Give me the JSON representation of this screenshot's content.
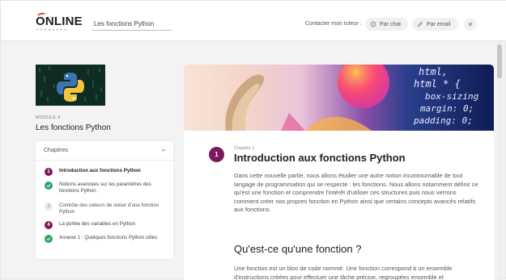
{
  "header": {
    "logo_text": "ONLINE",
    "logo_subtext": "FORMAPRO",
    "course_search_value": "Les fonctions Python",
    "tutor_label": "Contacter mon tuteur :",
    "chat_label": "Par chat",
    "email_label": "Par email",
    "close_label": "×"
  },
  "sidebar": {
    "module_label": "MODULE 4",
    "module_title": "Les fonctions Python",
    "chapters_label": "Chapitres",
    "chapters": [
      {
        "number": "1",
        "label": "Introduction aux fonctions Python",
        "state": "current"
      },
      {
        "number": "",
        "label": "Notions avancées sur les paramètres des fonctions Python",
        "state": "done"
      },
      {
        "number": "3",
        "label": "Contrôle des valeurs de retour d'une fonction Python",
        "state": "todo"
      },
      {
        "number": "4",
        "label": "La portée des variables en Python",
        "state": "current"
      },
      {
        "number": "",
        "label": "Annexe 1 : Quelques fonctions Python utiles",
        "state": "done"
      }
    ]
  },
  "main": {
    "hero_code": [
      "html,",
      "html * {",
      "box-sizing",
      "margin: 0;",
      "padding: 0;"
    ],
    "chapter_number": "1",
    "chapter_kicker": "Chapitre 1",
    "chapter_title": "Introduction aux fonctions Python",
    "intro_paragraph": "Dans cette nouvelle partie, nous allons étudier une autre notion incontournable de tout langage de programmation qui se respecte : les fonctions. Nous allons notamment définir ce qu'est une fonction et comprendre l'intérêt d'utiliser ces structures puis nous verrons comment créer nos propres fonction en Python ainsi que certains concepts avancés relatifs aux fonctions.",
    "section_title": "Qu'est-ce qu'une fonction ?",
    "section_paragraph": "Une fonction est un bloc de code nommé. Une fonction correspond à un ensemble d'instructions créées pour effectuer une tâche précise, regroupées ensemble et"
  },
  "colors": {
    "accent": "#7a1a5a",
    "done": "#2ba36d",
    "logo_swoosh": "#d33a3a"
  }
}
